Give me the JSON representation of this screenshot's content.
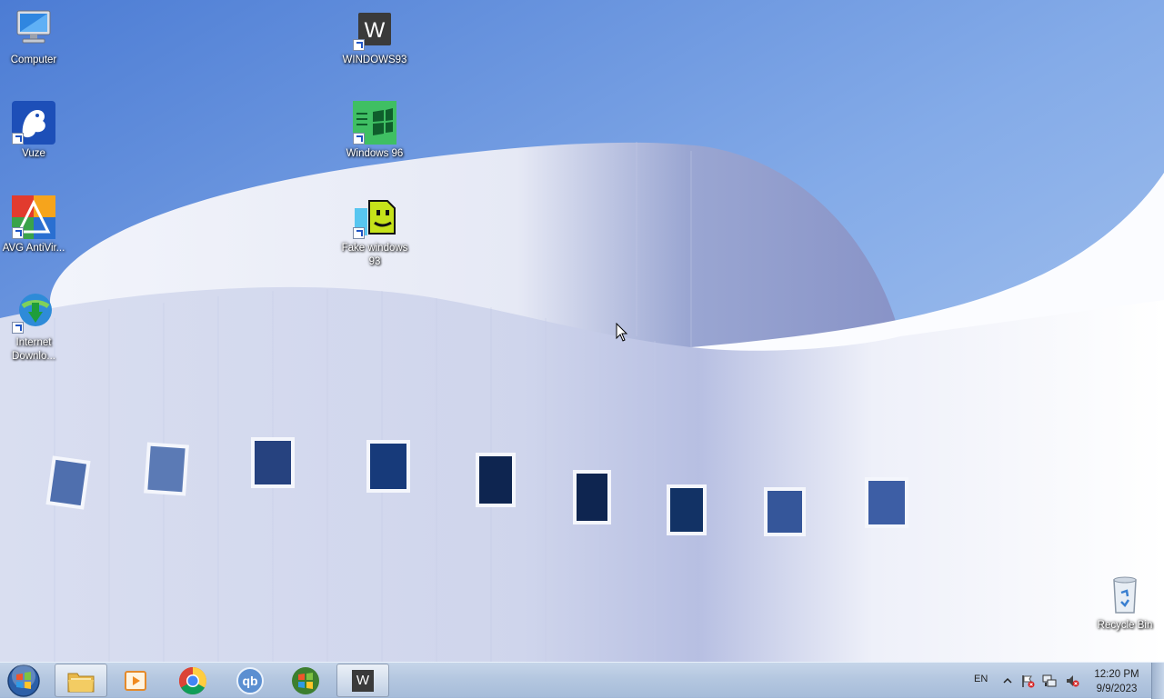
{
  "desktop": {
    "icons_left": [
      {
        "label": "Computer",
        "icon": "computer-icon"
      },
      {
        "label": "Vuze",
        "icon": "vuze-frog-icon"
      },
      {
        "label": "AVG AntiVir...",
        "icon": "avg-antivirus-icon"
      },
      {
        "label": "Internet Downlo...",
        "icon": "internet-download-manager-icon"
      }
    ],
    "icons_middle": [
      {
        "label": "WINDOWS93",
        "icon": "windows93-w-icon"
      },
      {
        "label": "Windows 96",
        "icon": "windows96-icon"
      },
      {
        "label": "Fake windows 93",
        "icon": "fake-windows93-icon"
      }
    ],
    "recycle_bin": {
      "label": "Recycle Bin",
      "icon": "recycle-bin-icon"
    }
  },
  "taskbar": {
    "pinned": [
      {
        "name": "windows-explorer",
        "icon": "folder-icon"
      },
      {
        "name": "media-player",
        "icon": "media-player-icon"
      },
      {
        "name": "chrome",
        "icon": "chrome-icon"
      },
      {
        "name": "qbittorrent",
        "icon": "qbittorrent-icon",
        "text": "qb"
      },
      {
        "name": "windows-96",
        "icon": "windows-logo-icon"
      },
      {
        "name": "windows93",
        "icon": "windows93-w-icon",
        "text": "W"
      }
    ],
    "language": "EN",
    "clock_time": "12:20 PM",
    "clock_date": "9/9/2023"
  },
  "colors": {
    "sky": "#6f9be0",
    "taskbar": "#b4c7e0",
    "label_text": "#ffffff"
  }
}
